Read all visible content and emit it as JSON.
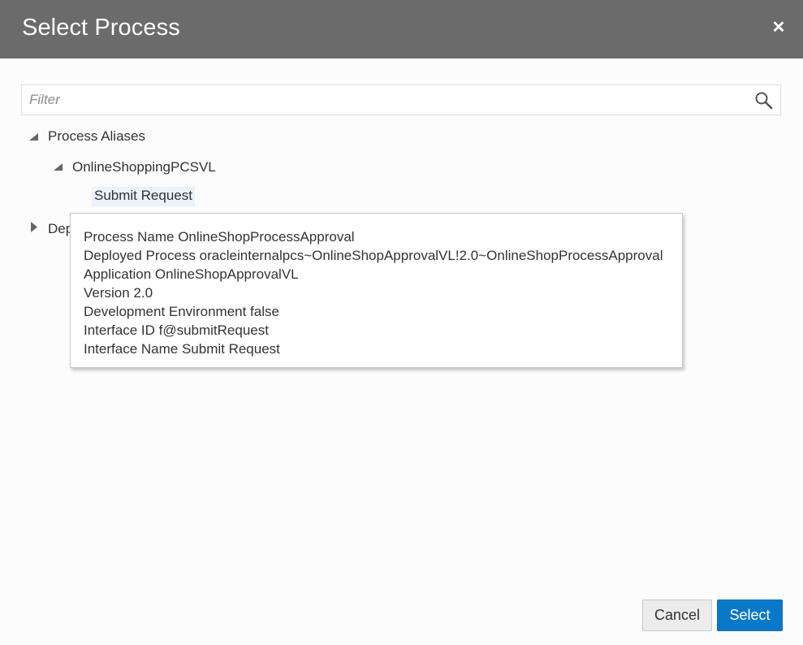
{
  "dialog": {
    "title": "Select Process",
    "close_icon": "close-icon"
  },
  "filter": {
    "placeholder": "Filter",
    "value": "",
    "icon": "search-icon"
  },
  "tree": {
    "root_label": "Process Aliases",
    "child_label": "OnlineShoppingPCSVL",
    "leaf_label": "Submit Request",
    "collapsed_label_partial": "Dep"
  },
  "tooltip": {
    "lines": [
      "Process Name OnlineShopProcessApproval",
      "Deployed Process oracleinternalpcs~OnlineShopApprovalVL!2.0~OnlineShopProcessApproval",
      "Application OnlineShopApprovalVL",
      "Version 2.0",
      "Development Environment false",
      "Interface ID f@submitRequest",
      "Interface Name Submit Request"
    ]
  },
  "buttons": {
    "cancel": "Cancel",
    "select": "Select"
  },
  "colors": {
    "header_bg": "#6b6b6b",
    "primary": "#0a78c8",
    "selection_bg": "#eaf2fb"
  }
}
